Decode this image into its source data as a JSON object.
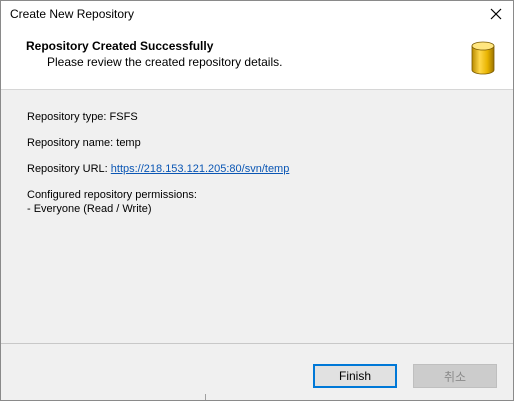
{
  "window": {
    "title": "Create New Repository"
  },
  "header": {
    "title": "Repository Created Successfully",
    "subtitle": "Please review the created repository details.",
    "icon": "database-cylinder-icon"
  },
  "details": {
    "type_label": "Repository type: FSFS",
    "name_label": "Repository name: temp",
    "url_prefix": "Repository URL: ",
    "url": "https://218.153.121.205:80/svn/temp",
    "permissions_title": "Configured repository permissions:",
    "permissions_entry": "- Everyone (Read / Write)"
  },
  "buttons": {
    "finish_label": "Finish",
    "cancel_label": "취소"
  },
  "colors": {
    "link": "#0a56b4",
    "accent": "#0078d7",
    "icon_gold": "#e8b400"
  }
}
